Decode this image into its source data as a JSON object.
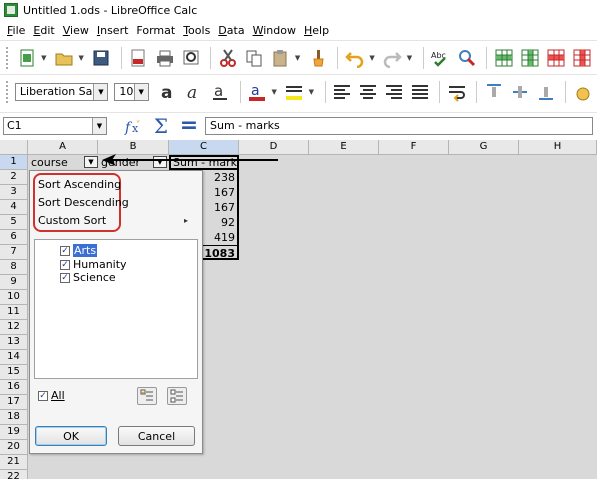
{
  "window": {
    "title": "Untitled 1.ods - LibreOffice Calc"
  },
  "menu": [
    {
      "first": "F",
      "rest": "ile"
    },
    {
      "first": "E",
      "rest": "dit"
    },
    {
      "first": "V",
      "rest": "iew"
    },
    {
      "first": "I",
      "rest": "nsert"
    },
    {
      "first": "",
      "rest": "Format"
    },
    {
      "first": "T",
      "rest": "ools"
    },
    {
      "first": "D",
      "rest": "ata"
    },
    {
      "first": "W",
      "rest": "indow"
    },
    {
      "first": "H",
      "rest": "elp"
    }
  ],
  "toolbar": {
    "font_name": "Liberation Sans",
    "font_size": "10"
  },
  "formula_bar": {
    "cell_ref": "C1",
    "content": "Sum - marks"
  },
  "columns": [
    "A",
    "B",
    "C",
    "D",
    "E",
    "F",
    "G",
    "H"
  ],
  "rows": [
    "1",
    "2",
    "3",
    "4",
    "5",
    "6",
    "7",
    "8",
    "9",
    "10",
    "11",
    "12",
    "13",
    "14",
    "15",
    "16",
    "17",
    "18",
    "19",
    "20",
    "21",
    "22"
  ],
  "sheet": {
    "a1": "course",
    "b1": "gender",
    "c1": "Sum - marks",
    "c_values": [
      "238",
      "167",
      "167",
      "92",
      "419",
      "1083"
    ]
  },
  "popup": {
    "sort_ascending": "Sort Ascending",
    "sort_descending": "Sort Descending",
    "custom_sort": "Custom Sort",
    "items": [
      "Arts",
      "Humanity",
      "Science"
    ],
    "all_label": "All",
    "ok": "OK",
    "cancel": "Cancel"
  },
  "colors": {
    "highlight_ring": "#d0312d",
    "selection": "#3b6fd1",
    "header_active": "#c8d8ef"
  }
}
